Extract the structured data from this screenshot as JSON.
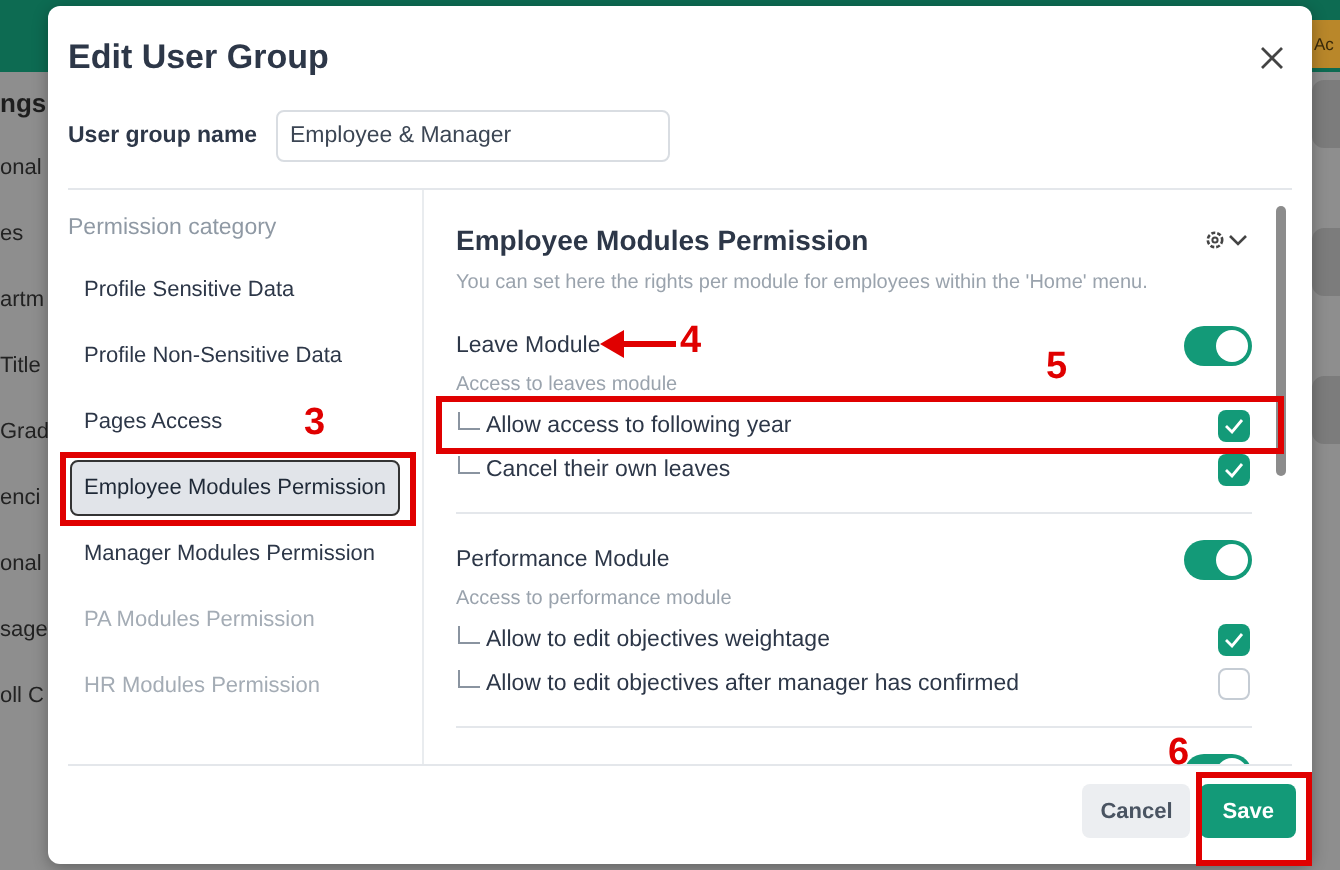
{
  "background": {
    "heading_fragment": "ngs",
    "menu_fragments": [
      "onal",
      "es",
      "artm",
      "Title",
      "Grad",
      "enci",
      "onal",
      "sage",
      "oll C"
    ],
    "action_fragment": "Ac"
  },
  "dialog": {
    "title": "Edit User Group"
  },
  "name_field": {
    "label": "User group name",
    "value": "Employee & Manager"
  },
  "categories": {
    "heading": "Permission category",
    "items": [
      {
        "label": "Profile Sensitive Data",
        "selected": false,
        "disabled": false
      },
      {
        "label": "Profile Non-Sensitive Data",
        "selected": false,
        "disabled": false
      },
      {
        "label": "Pages Access",
        "selected": false,
        "disabled": false
      },
      {
        "label": "Employee Modules Permission",
        "selected": true,
        "disabled": false
      },
      {
        "label": "Manager Modules Permission",
        "selected": false,
        "disabled": false
      },
      {
        "label": "PA Modules Permission",
        "selected": false,
        "disabled": true
      },
      {
        "label": "HR Modules Permission",
        "selected": false,
        "disabled": true
      }
    ]
  },
  "panel": {
    "title": "Employee Modules Permission",
    "description": "You can set here the rights per module for employees within the 'Home' menu.",
    "modules": [
      {
        "title": "Leave Module",
        "subtitle": "Access to leaves module",
        "on": true,
        "options": [
          {
            "label": "Allow access to following year",
            "checked": true
          },
          {
            "label": "Cancel their own leaves",
            "checked": true
          }
        ]
      },
      {
        "title": "Performance Module",
        "subtitle": "Access to performance module",
        "on": true,
        "options": [
          {
            "label": "Allow to edit objectives weightage",
            "checked": true
          },
          {
            "label": "Allow to edit objectives after manager has confirmed",
            "checked": false
          }
        ]
      },
      {
        "on": true
      }
    ]
  },
  "buttons": [
    {
      "label": "Cancel",
      "kind": "secondary"
    },
    {
      "label": "Save",
      "kind": "primary"
    }
  ],
  "annotations": [
    {
      "label": "3",
      "kind": "box"
    },
    {
      "label": "4",
      "kind": "arrow"
    },
    {
      "label": "5",
      "kind": "box"
    },
    {
      "label": "6",
      "kind": "box"
    }
  ]
}
